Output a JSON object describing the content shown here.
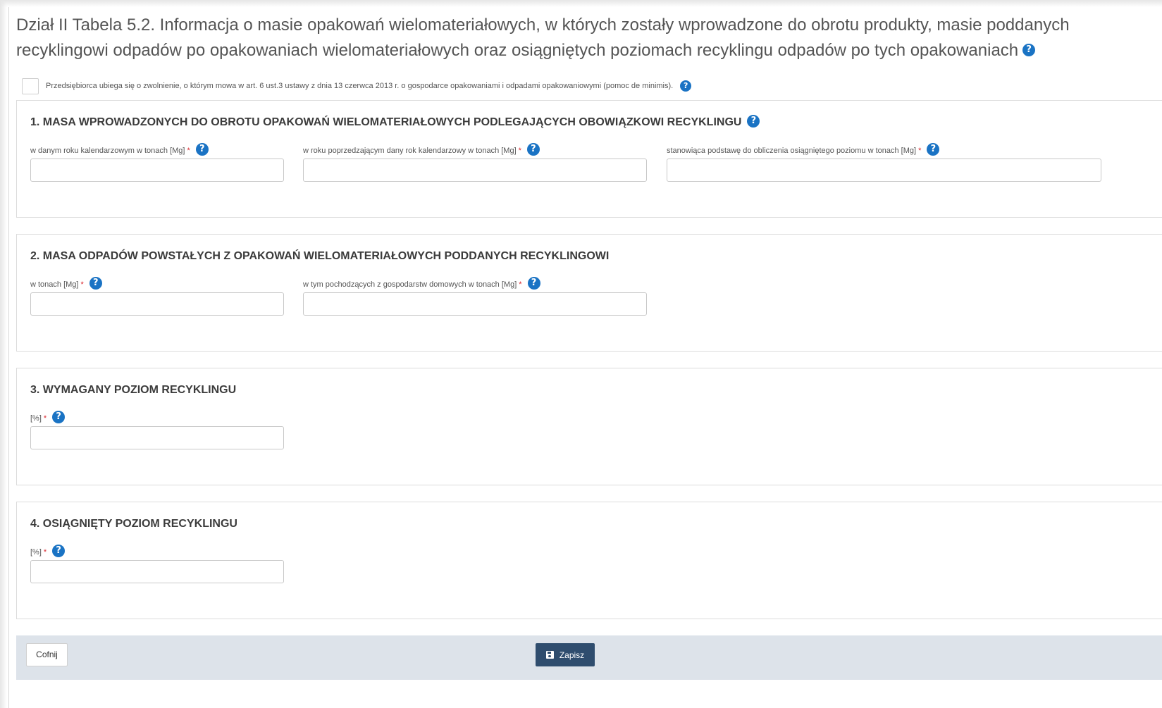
{
  "page": {
    "title": "Dział II Tabela 5.2. Informacja o masie opakowań wielomateriałowych, w których zostały wprowadzone do obrotu produkty, masie poddanych recyklingowi odpadów po opakowaniach wielomateriałowych oraz osiągniętych poziomach recyklingu odpadów po tych opakowaniach",
    "help_glyph": "?"
  },
  "deminimis": {
    "label": "Przedsiębiorca ubiega się o zwolnienie, o którym mowa w art. 6 ust.3 ustawy z dnia 13 czerwca 2013 r. o gospodarce opakowaniami i odpadami opakowaniowymi (pomoc de minimis).",
    "checked": false
  },
  "required_mark": "*",
  "sections": [
    {
      "title": "1. MASA WPROWADZONYCH DO OBROTU OPAKOWAŃ WIELOMATERIAŁOWYCH PODLEGAJĄCYCH OBOWIĄZKOWI RECYKLINGU",
      "fields": [
        {
          "label": "w danym roku kalendarzowym w tonach [Mg]",
          "value": ""
        },
        {
          "label": "w roku poprzedzającym dany rok kalendarzowy w tonach [Mg]",
          "value": ""
        },
        {
          "label": "stanowiąca podstawę do obliczenia osiągniętego poziomu w tonach [Mg]",
          "value": ""
        }
      ]
    },
    {
      "title": "2. MASA ODPADÓW POWSTAŁYCH Z OPAKOWAŃ WIELOMATERIAŁOWYCH PODDANYCH RECYKLINGOWI",
      "fields": [
        {
          "label": "w tonach [Mg]",
          "value": ""
        },
        {
          "label": "w tym pochodzących z gospodarstw domowych w tonach [Mg]",
          "value": ""
        }
      ]
    },
    {
      "title": "3. WYMAGANY POZIOM RECYKLINGU",
      "fields": [
        {
          "label": "[%]",
          "value": ""
        }
      ]
    },
    {
      "title": "4. OSIĄGNIĘTY POZIOM RECYKLINGU",
      "fields": [
        {
          "label": "[%]",
          "value": ""
        }
      ]
    }
  ],
  "footer": {
    "back_label": "Cofnij",
    "save_label": "Zapisz"
  },
  "icons": {
    "help": "question-circle-icon",
    "save": "floppy-disk-icon"
  },
  "colors": {
    "help_blue": "#1a73c4",
    "save_button": "#2f4d6e",
    "footer_bg": "#dde3ea",
    "required": "#d9272e"
  }
}
